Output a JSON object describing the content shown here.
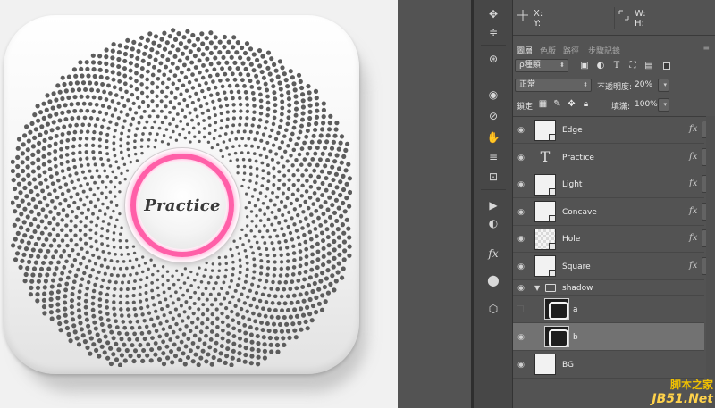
{
  "canvas": {
    "device_label": "Practice",
    "ring_color": "#ff5fa8",
    "body_color": "#f4f4f4"
  },
  "toolbar": {
    "icons": [
      "arrows-move-icon",
      "sliders-icon",
      "globe-icon",
      "eye-icon",
      "paperclip-icon",
      "hand-icon",
      "stripes-icon",
      "export-icon",
      "play-icon",
      "circle-half-icon",
      "fx-icon",
      "drop-icon",
      "cube-icon"
    ]
  },
  "info": {
    "x_label": "X:",
    "y_label": "Y:",
    "w_label": "W:",
    "h_label": "H:"
  },
  "tabs": {
    "layers": "圖層",
    "channels": "色版",
    "paths": "路徑",
    "history": "步驟記錄",
    "menu": "≡"
  },
  "filter": {
    "kind_label": "種類",
    "search_symbol": "ρ"
  },
  "blend": {
    "mode": "正常",
    "opacity_label": "不透明度:",
    "opacity_value": "20%",
    "lock_label": "鎖定:",
    "fill_label": "填滿:",
    "fill_value": "100%"
  },
  "layers": [
    {
      "name": "Edge",
      "type": "smart",
      "fx": "fx",
      "visible": true
    },
    {
      "name": "Practice",
      "type": "text",
      "fx": "fx",
      "visible": true
    },
    {
      "name": "Light",
      "type": "smart",
      "fx": "fx",
      "visible": true
    },
    {
      "name": "Concave",
      "type": "smart",
      "fx": "fx",
      "visible": true
    },
    {
      "name": "Hole",
      "type": "smart",
      "fx": "fx",
      "visible": true
    },
    {
      "name": "Square",
      "type": "smart",
      "fx": "fx",
      "visible": true
    },
    {
      "name": "shadow",
      "type": "group",
      "fx": "",
      "visible": true
    },
    {
      "name": "a",
      "type": "shape",
      "fx": "",
      "visible": false
    },
    {
      "name": "b",
      "type": "shape",
      "fx": "",
      "visible": true,
      "selected": true
    },
    {
      "name": "BG",
      "type": "fill",
      "fx": "",
      "visible": true
    }
  ],
  "watermark": {
    "line1": "脚本之家",
    "line2": "JB51.Net"
  }
}
